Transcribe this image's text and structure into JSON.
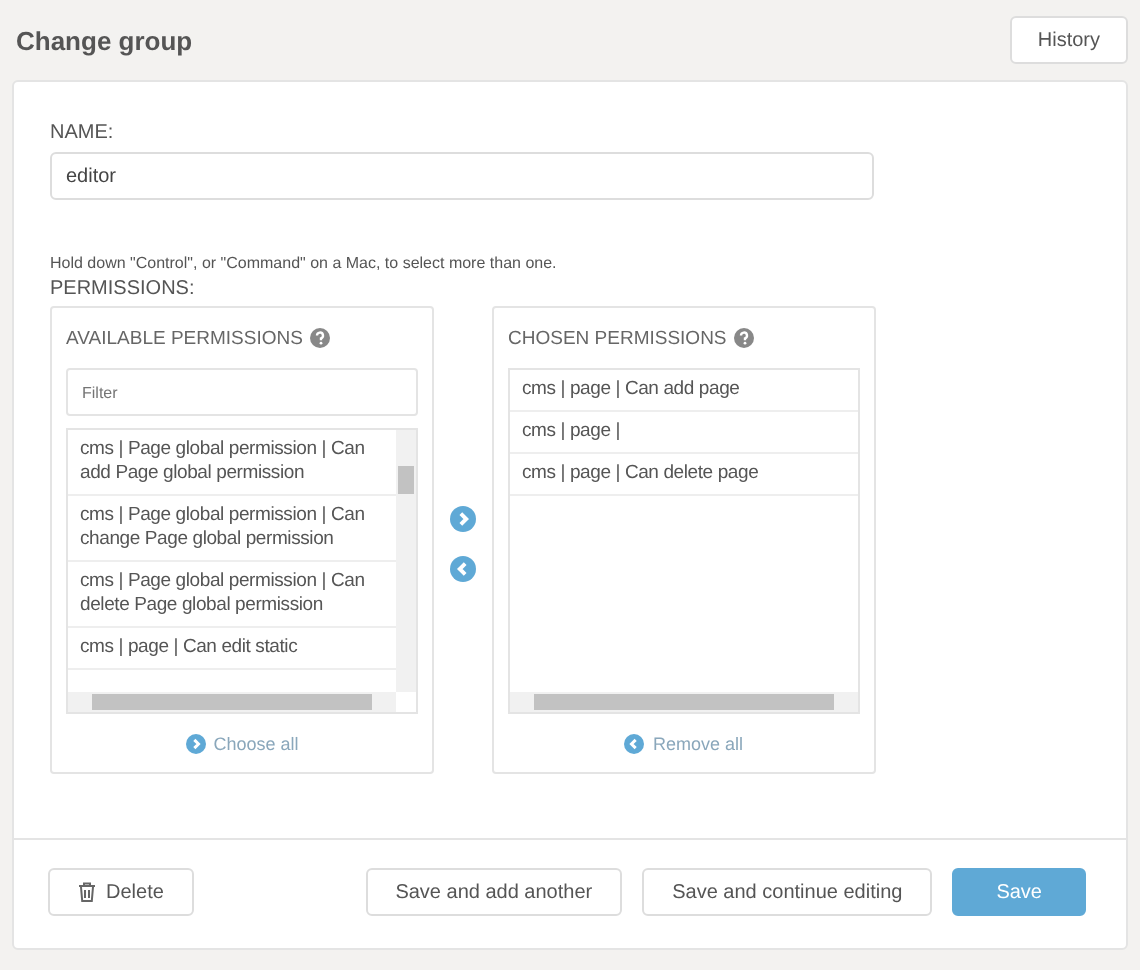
{
  "header": {
    "title": "Change group",
    "history_button": "History"
  },
  "name_field": {
    "label": "NAME:",
    "value": "editor"
  },
  "help_text": "Hold down \"Control\", or \"Command\" on a Mac, to select more than one.",
  "permissions_label": "PERMISSIONS:",
  "available": {
    "title": "AVAILABLE PERMISSIONS",
    "filter_placeholder": "Filter",
    "items": [
      {
        "label": "cms | Page global permission | Can add Page global permission"
      },
      {
        "label": "cms | Page global permission | Can change Page global permission"
      },
      {
        "label": "cms | Page global permission | Can delete Page global permission"
      },
      {
        "label": "cms | page | Can edit static"
      }
    ],
    "action": "Choose all"
  },
  "chosen": {
    "title": "CHOSEN PERMISSIONS",
    "items": [
      {
        "label": "cms | page | Can add page"
      },
      {
        "label": "cms | page |"
      },
      {
        "label": "cms | page | Can delete page"
      }
    ],
    "action": "Remove all"
  },
  "footer": {
    "delete_button": "Delete",
    "buttons": [
      {
        "label": "Save and add another",
        "kind": "default"
      },
      {
        "label": "Save and continue editing",
        "kind": "default"
      },
      {
        "label": "Save",
        "kind": "primary"
      }
    ]
  }
}
